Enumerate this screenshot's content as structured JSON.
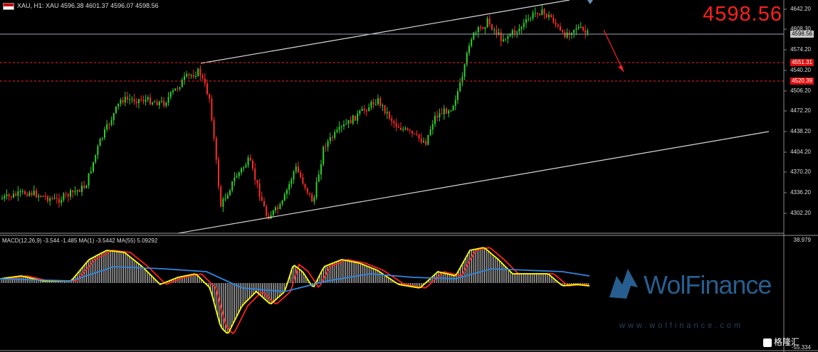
{
  "header": {
    "text": "XAU, H1:  XAU  4596.38 4601.37 4596.07 4598.56"
  },
  "big_price": "4598.56",
  "price_axis": [
    "4642.20",
    "4608.30",
    "4574.20",
    "4540.20",
    "4506.20",
    "4472.20",
    "4438.20",
    "4404.20",
    "4370.20",
    "4336.20",
    "4302.20"
  ],
  "tags": {
    "current": "4598.56",
    "level1": "4551.31",
    "level2": "4520.39"
  },
  "macd": {
    "label": "MACD(12,26,9) -3.544 -1.485 MA(1) -3.5442 MA(55) 5.09292",
    "axis_top": "38.979",
    "axis_bottom": "-55.334"
  },
  "watermark": {
    "brand": "WolFinance",
    "url": "www.wolfinance.com"
  },
  "badge": {
    "text": "格隆汇"
  },
  "colors": {
    "bull": "#2fd02f",
    "bear": "#ff2a2a",
    "channel": "#d8d8d8",
    "level": "#ff2020",
    "macd_fast": "#ffff00",
    "macd_slow": "#ff2020",
    "macd_ma": "#2f86e0",
    "hist": "#dcdcdc"
  }
}
